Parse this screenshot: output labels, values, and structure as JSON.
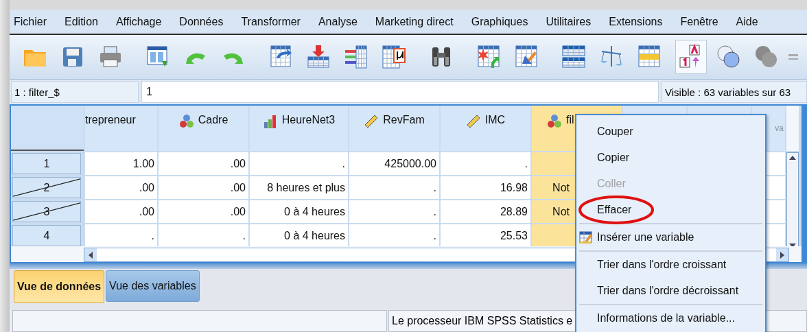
{
  "menu": [
    {
      "label": "Fichier"
    },
    {
      "label": "Edition"
    },
    {
      "label": "Affichage"
    },
    {
      "label": "Données"
    },
    {
      "label": "Transformer"
    },
    {
      "label": "Analyse"
    },
    {
      "label": "Marketing direct"
    },
    {
      "label": "Graphiques"
    },
    {
      "label": "Utilitaires"
    },
    {
      "label": "Extensions"
    },
    {
      "label": "Fenêtre"
    },
    {
      "label": "Aide"
    }
  ],
  "toolbar": {
    "value_labels_on": true
  },
  "cell_editor": {
    "cell_name": "1 : filter_$",
    "value": "1",
    "visible_info": "Visible : 63 variables sur 63"
  },
  "grid": {
    "columns": [
      {
        "label": "trepreneur",
        "kind": "plain",
        "selected": false
      },
      {
        "label": "Cadre",
        "kind": "nominal",
        "selected": false
      },
      {
        "label": "HeureNet3",
        "kind": "ordinal",
        "selected": false
      },
      {
        "label": "RevFam",
        "kind": "scale",
        "selected": false
      },
      {
        "label": "IMC",
        "kind": "scale",
        "selected": false
      },
      {
        "label": "fil",
        "kind": "nominal",
        "selected": true
      },
      {
        "label": "va",
        "kind": "plain",
        "selected": false
      }
    ],
    "rows": [
      {
        "label": "1",
        "filtered_out": false,
        "cells": [
          "1.00",
          ".00",
          ".",
          "425000.00",
          "."
        ]
      },
      {
        "label": "2",
        "filtered_out": true,
        "cells": [
          ".00",
          ".00",
          "8 heures et plus",
          ".",
          "16.98",
          "Not"
        ]
      },
      {
        "label": "3",
        "filtered_out": true,
        "cells": [
          ".00",
          ".00",
          "0 à 4 heures",
          ".",
          "28.89",
          "Not"
        ]
      },
      {
        "label": "4",
        "filtered_out": false,
        "cells": [
          ".",
          ".",
          "0 à 4 heures",
          ".",
          "25.53"
        ]
      }
    ]
  },
  "context_menu": {
    "items": [
      {
        "kind": "item",
        "label": "Couper",
        "disabled": false,
        "circled": false
      },
      {
        "kind": "item",
        "label": "Copier",
        "disabled": false,
        "circled": false
      },
      {
        "kind": "item",
        "label": "Coller",
        "disabled": true,
        "circled": false
      },
      {
        "kind": "item",
        "label": "Effacer",
        "disabled": false,
        "circled": true
      },
      {
        "kind": "separator"
      },
      {
        "kind": "icon_item",
        "label": "Insérer une variable",
        "disabled": false,
        "circled": false
      },
      {
        "kind": "separator"
      },
      {
        "kind": "item",
        "label": "Trier dans l'ordre croissant",
        "disabled": false,
        "circled": false
      },
      {
        "kind": "item",
        "label": "Trier dans l'ordre décroissant",
        "disabled": false,
        "circled": false
      },
      {
        "kind": "separator"
      },
      {
        "kind": "item",
        "label": "Informations de la variable...",
        "disabled": false,
        "circled": false
      }
    ]
  },
  "tabs": [
    {
      "label": "Vue de données",
      "selected": true
    },
    {
      "label": "Vue des variables",
      "selected": false
    }
  ],
  "status_bar": {
    "message": "Le processeur IBM SPSS Statistics  e"
  }
}
